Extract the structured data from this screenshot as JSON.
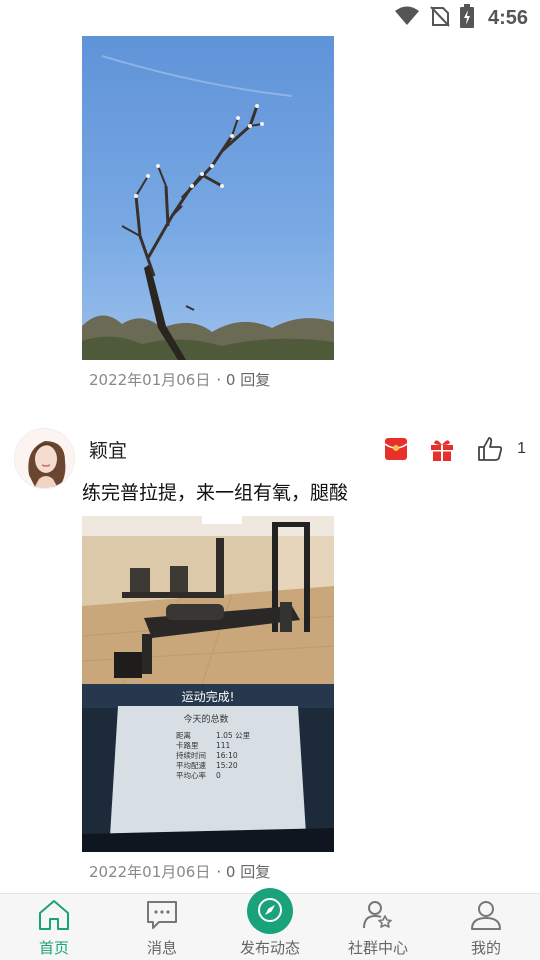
{
  "status_bar": {
    "time": "4:56",
    "icons": [
      "wifi-icon",
      "no-sim-icon",
      "battery-charging-icon"
    ]
  },
  "feed": {
    "posts": [
      {
        "image_description_icon": "sky-tree-photo",
        "date": "2022年01月06日",
        "replies": "· 0 回复"
      },
      {
        "username": "颖宜",
        "text": "练完普拉提，来一组有氧，腿酸",
        "image_icon": "pilates-studio-photo",
        "screen": {
          "heading": "运动完成!",
          "subheading": "今天的总数",
          "rows": [
            {
              "label": "距离",
              "value": "1.05 公里"
            },
            {
              "label": "卡路里",
              "value": "111"
            },
            {
              "label": "持续时间",
              "value": "16:10"
            },
            {
              "label": "平均配速",
              "value": "15:20"
            },
            {
              "label": "平均心率",
              "value": "0"
            }
          ]
        },
        "date": "2022年01月06日",
        "replies": "· 0 回复",
        "actions": {
          "icons": [
            "red-envelope-icon",
            "gift-icon",
            "thumbs-up-icon"
          ],
          "like_count": "1"
        }
      }
    ]
  },
  "bottom_nav": {
    "items": [
      {
        "label": "首页",
        "icon": "home-icon",
        "active": true
      },
      {
        "label": "消息",
        "icon": "message-icon",
        "active": false
      },
      {
        "label": "发布动态",
        "icon": "compass-icon",
        "active": false
      },
      {
        "label": "社群中心",
        "icon": "community-icon",
        "active": false
      },
      {
        "label": "我的",
        "icon": "profile-icon",
        "active": false
      }
    ]
  },
  "colors": {
    "accent": "#1aa37a",
    "red_envelope": "#e8302a",
    "meta_text": "#888888"
  }
}
